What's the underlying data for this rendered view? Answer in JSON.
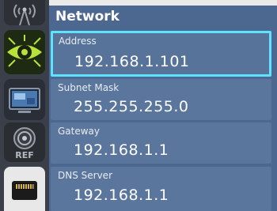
{
  "panel": {
    "title": "Network"
  },
  "fields": {
    "address": {
      "label": "Address",
      "value": "192.168.1.101"
    },
    "subnet": {
      "label": "Subnet Mask",
      "value": "255.255.255.0"
    },
    "gateway": {
      "label": "Gateway",
      "value": "192.168.1.1"
    },
    "dns": {
      "label": "DNS Server",
      "value": "192.168.1.1"
    }
  },
  "sidebar": {
    "items": [
      {
        "icon": "antenna-icon"
      },
      {
        "icon": "eye-icon"
      },
      {
        "icon": "display-icon"
      },
      {
        "icon": "ref-sensor-icon",
        "label": "REF"
      },
      {
        "icon": "ethernet-icon",
        "selected": true
      }
    ]
  },
  "colors": {
    "panel_bg": "#4c6790",
    "field_bg": "#5b769c",
    "focus_border": "#5ee3ff",
    "eye_green": "#b6e23a"
  }
}
